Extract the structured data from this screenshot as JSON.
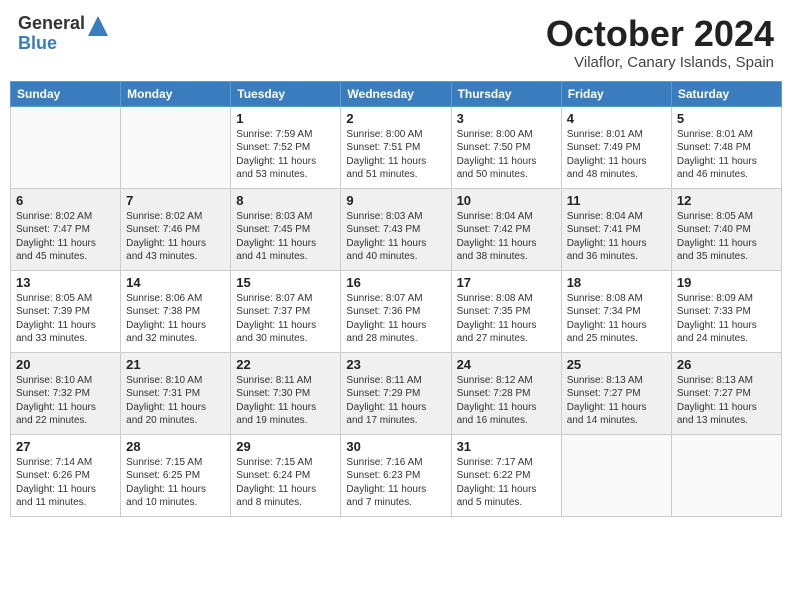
{
  "header": {
    "logo_general": "General",
    "logo_blue": "Blue",
    "month_title": "October 2024",
    "location": "Vilaflor, Canary Islands, Spain"
  },
  "weekdays": [
    "Sunday",
    "Monday",
    "Tuesday",
    "Wednesday",
    "Thursday",
    "Friday",
    "Saturday"
  ],
  "weeks": [
    [
      {
        "day": "",
        "info": ""
      },
      {
        "day": "",
        "info": ""
      },
      {
        "day": "1",
        "info": "Sunrise: 7:59 AM\nSunset: 7:52 PM\nDaylight: 11 hours and 53 minutes."
      },
      {
        "day": "2",
        "info": "Sunrise: 8:00 AM\nSunset: 7:51 PM\nDaylight: 11 hours and 51 minutes."
      },
      {
        "day": "3",
        "info": "Sunrise: 8:00 AM\nSunset: 7:50 PM\nDaylight: 11 hours and 50 minutes."
      },
      {
        "day": "4",
        "info": "Sunrise: 8:01 AM\nSunset: 7:49 PM\nDaylight: 11 hours and 48 minutes."
      },
      {
        "day": "5",
        "info": "Sunrise: 8:01 AM\nSunset: 7:48 PM\nDaylight: 11 hours and 46 minutes."
      }
    ],
    [
      {
        "day": "6",
        "info": "Sunrise: 8:02 AM\nSunset: 7:47 PM\nDaylight: 11 hours and 45 minutes."
      },
      {
        "day": "7",
        "info": "Sunrise: 8:02 AM\nSunset: 7:46 PM\nDaylight: 11 hours and 43 minutes."
      },
      {
        "day": "8",
        "info": "Sunrise: 8:03 AM\nSunset: 7:45 PM\nDaylight: 11 hours and 41 minutes."
      },
      {
        "day": "9",
        "info": "Sunrise: 8:03 AM\nSunset: 7:43 PM\nDaylight: 11 hours and 40 minutes."
      },
      {
        "day": "10",
        "info": "Sunrise: 8:04 AM\nSunset: 7:42 PM\nDaylight: 11 hours and 38 minutes."
      },
      {
        "day": "11",
        "info": "Sunrise: 8:04 AM\nSunset: 7:41 PM\nDaylight: 11 hours and 36 minutes."
      },
      {
        "day": "12",
        "info": "Sunrise: 8:05 AM\nSunset: 7:40 PM\nDaylight: 11 hours and 35 minutes."
      }
    ],
    [
      {
        "day": "13",
        "info": "Sunrise: 8:05 AM\nSunset: 7:39 PM\nDaylight: 11 hours and 33 minutes."
      },
      {
        "day": "14",
        "info": "Sunrise: 8:06 AM\nSunset: 7:38 PM\nDaylight: 11 hours and 32 minutes."
      },
      {
        "day": "15",
        "info": "Sunrise: 8:07 AM\nSunset: 7:37 PM\nDaylight: 11 hours and 30 minutes."
      },
      {
        "day": "16",
        "info": "Sunrise: 8:07 AM\nSunset: 7:36 PM\nDaylight: 11 hours and 28 minutes."
      },
      {
        "day": "17",
        "info": "Sunrise: 8:08 AM\nSunset: 7:35 PM\nDaylight: 11 hours and 27 minutes."
      },
      {
        "day": "18",
        "info": "Sunrise: 8:08 AM\nSunset: 7:34 PM\nDaylight: 11 hours and 25 minutes."
      },
      {
        "day": "19",
        "info": "Sunrise: 8:09 AM\nSunset: 7:33 PM\nDaylight: 11 hours and 24 minutes."
      }
    ],
    [
      {
        "day": "20",
        "info": "Sunrise: 8:10 AM\nSunset: 7:32 PM\nDaylight: 11 hours and 22 minutes."
      },
      {
        "day": "21",
        "info": "Sunrise: 8:10 AM\nSunset: 7:31 PM\nDaylight: 11 hours and 20 minutes."
      },
      {
        "day": "22",
        "info": "Sunrise: 8:11 AM\nSunset: 7:30 PM\nDaylight: 11 hours and 19 minutes."
      },
      {
        "day": "23",
        "info": "Sunrise: 8:11 AM\nSunset: 7:29 PM\nDaylight: 11 hours and 17 minutes."
      },
      {
        "day": "24",
        "info": "Sunrise: 8:12 AM\nSunset: 7:28 PM\nDaylight: 11 hours and 16 minutes."
      },
      {
        "day": "25",
        "info": "Sunrise: 8:13 AM\nSunset: 7:27 PM\nDaylight: 11 hours and 14 minutes."
      },
      {
        "day": "26",
        "info": "Sunrise: 8:13 AM\nSunset: 7:27 PM\nDaylight: 11 hours and 13 minutes."
      }
    ],
    [
      {
        "day": "27",
        "info": "Sunrise: 7:14 AM\nSunset: 6:26 PM\nDaylight: 11 hours and 11 minutes."
      },
      {
        "day": "28",
        "info": "Sunrise: 7:15 AM\nSunset: 6:25 PM\nDaylight: 11 hours and 10 minutes."
      },
      {
        "day": "29",
        "info": "Sunrise: 7:15 AM\nSunset: 6:24 PM\nDaylight: 11 hours and 8 minutes."
      },
      {
        "day": "30",
        "info": "Sunrise: 7:16 AM\nSunset: 6:23 PM\nDaylight: 11 hours and 7 minutes."
      },
      {
        "day": "31",
        "info": "Sunrise: 7:17 AM\nSunset: 6:22 PM\nDaylight: 11 hours and 5 minutes."
      },
      {
        "day": "",
        "info": ""
      },
      {
        "day": "",
        "info": ""
      }
    ]
  ]
}
